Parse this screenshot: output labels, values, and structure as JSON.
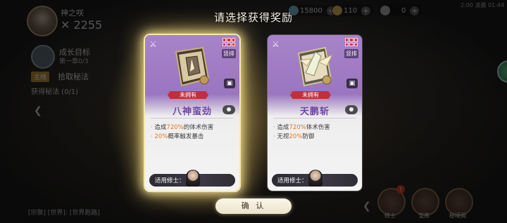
{
  "title": "请选择获得奖励",
  "background": {
    "player_name": "神之咲",
    "power": "✕ 2255",
    "resources": [
      {
        "icon": "jade-icon",
        "value": "15800"
      },
      {
        "icon": "coin-icon",
        "value": "110"
      },
      {
        "icon": "token-icon",
        "value": "0"
      }
    ],
    "clock": "2:00 凌晨 01:44",
    "goal": {
      "title": "成长目标",
      "sub": "第一章0/3"
    },
    "task": {
      "tag": "主线",
      "text": "拾取秘法"
    },
    "got": "获得秘法 (0/1)",
    "chat": "[宗聚] [世界]: [世界跑路]",
    "bottom_buttons": [
      {
        "label": "修士",
        "badge": "!"
      },
      {
        "label": "宝库"
      },
      {
        "label": "秘境阁"
      }
    ]
  },
  "cards": [
    {
      "selected": true,
      "type_label": "竖排",
      "status": "未拥有",
      "name": "八神蛮劲",
      "desc": [
        {
          "pre": "造成",
          "hl": "720%",
          "post": "的体术伤害"
        },
        {
          "pre": "",
          "hl": "20%",
          "post": "概率触发暴击"
        }
      ],
      "applies_label": "适用修士："
    },
    {
      "selected": false,
      "type_label": "竖排",
      "status": "未拥有",
      "name": "天鹏斩",
      "desc": [
        {
          "pre": "造成",
          "hl": "720%",
          "post": "体术伤害"
        },
        {
          "pre": "无视",
          "hl": "20%",
          "post": "防御"
        }
      ],
      "applies_label": "适用修士："
    }
  ],
  "confirm_label": "确 认",
  "colors": {
    "card_purple": "#a783c9",
    "name_purple": "#7046a6",
    "highlight": "#e07a1e",
    "status_red": "#c0303b"
  }
}
